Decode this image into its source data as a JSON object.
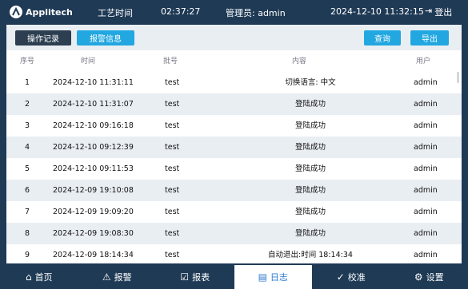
{
  "header": {
    "brand": "Applitech",
    "process_time_label": "工艺时间",
    "process_time": "02:37:27",
    "admin_label": "管理员: admin",
    "datetime": "2024-12-10 11:32:15",
    "logout_label": "登出"
  },
  "toolbar": {
    "tabs": [
      {
        "label": "操作记录"
      },
      {
        "label": "报警信息"
      }
    ],
    "query_label": "查询",
    "export_label": "导出"
  },
  "table": {
    "columns": [
      "序号",
      "时间",
      "批号",
      "内容",
      "用户"
    ],
    "rows": [
      {
        "no": "1",
        "time": "2024-12-10 11:31:11",
        "batch": "test",
        "content": "切换语言: 中文",
        "user": "admin"
      },
      {
        "no": "2",
        "time": "2024-12-10 11:31:07",
        "batch": "test",
        "content": "登陆成功",
        "user": "admin"
      },
      {
        "no": "3",
        "time": "2024-12-10 09:16:18",
        "batch": "test",
        "content": "登陆成功",
        "user": "admin"
      },
      {
        "no": "4",
        "time": "2024-12-10 09:12:39",
        "batch": "test",
        "content": "登陆成功",
        "user": "admin"
      },
      {
        "no": "5",
        "time": "2024-12-10 09:11:53",
        "batch": "test",
        "content": "登陆成功",
        "user": "admin"
      },
      {
        "no": "6",
        "time": "2024-12-09 19:10:08",
        "batch": "test",
        "content": "登陆成功",
        "user": "admin"
      },
      {
        "no": "7",
        "time": "2024-12-09 19:09:20",
        "batch": "test",
        "content": "登陆成功",
        "user": "admin"
      },
      {
        "no": "8",
        "time": "2024-12-09 19:08:30",
        "batch": "test",
        "content": "登陆成功",
        "user": "admin"
      },
      {
        "no": "9",
        "time": "2024-12-09 18:14:34",
        "batch": "test",
        "content": "自动退出:时间 18:14:34",
        "user": "admin"
      }
    ]
  },
  "nav": {
    "items": [
      {
        "label": "首页",
        "icon": "home-icon",
        "glyph": "⌂"
      },
      {
        "label": "报警",
        "icon": "alarm-icon",
        "glyph": "⚠"
      },
      {
        "label": "报表",
        "icon": "report-icon",
        "glyph": "☑"
      },
      {
        "label": "日志",
        "icon": "log-icon",
        "glyph": "▤"
      },
      {
        "label": "校准",
        "icon": "calibrate-icon",
        "glyph": "✓"
      },
      {
        "label": "设置",
        "icon": "settings-icon",
        "glyph": "⚙"
      }
    ],
    "active_index": 3
  },
  "colors": {
    "accent": "#2f7bd0",
    "header_bg": "#1f3a55",
    "button_blue": "#22a7e0"
  }
}
